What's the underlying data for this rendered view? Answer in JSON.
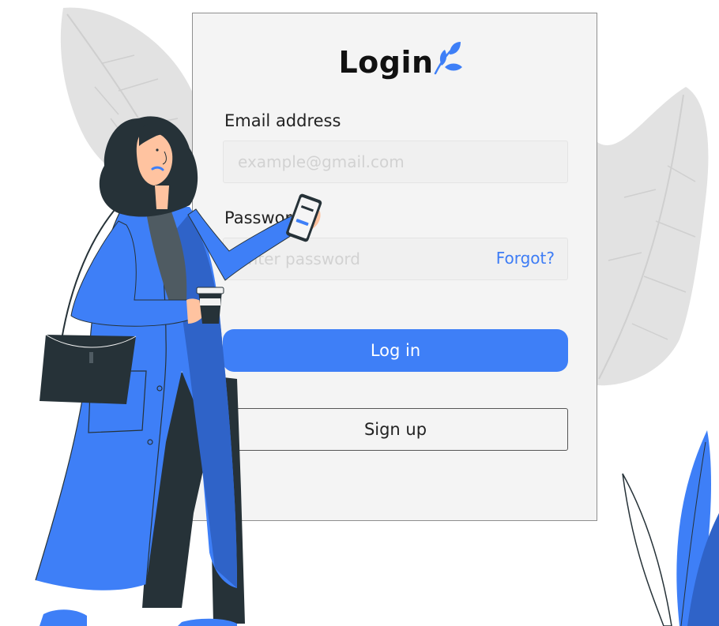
{
  "card": {
    "title": "Login",
    "email": {
      "label": "Email address",
      "placeholder": "example@gmail.com",
      "value": ""
    },
    "password": {
      "label": "Password",
      "placeholder": "Enter password",
      "value": "",
      "forgot_label": "Forgot?"
    },
    "login_button": "Log in",
    "signup_button": "Sign up"
  },
  "colors": {
    "accent": "#3e7ff7",
    "card_bg": "#f4f4f4",
    "text": "#111111",
    "coat": "#3e7ff7",
    "hair": "#263238",
    "leaf_gray": "#e3e3e3"
  },
  "illustration": {
    "subject": "woman-with-phone-and-coffee",
    "icons": [
      "leaf-logo-icon",
      "leaf-decoration",
      "plant-decoration"
    ]
  }
}
